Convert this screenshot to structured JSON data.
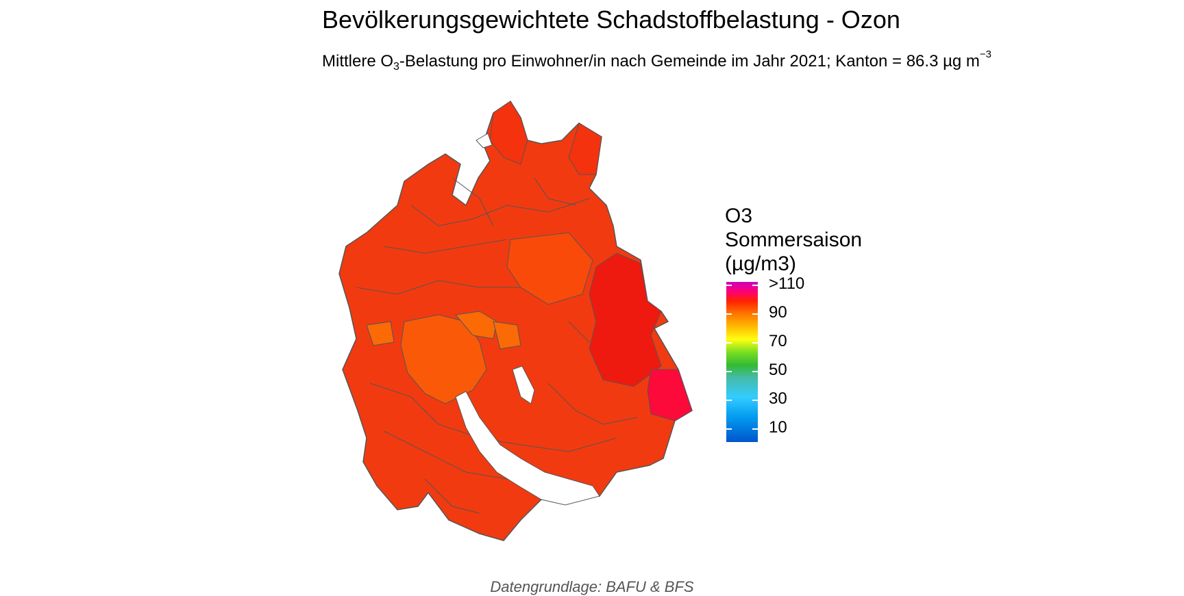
{
  "title": "Bevölkerungsgewichtete Schadstoffbelastung - Ozon",
  "subtitle": {
    "pre": "Mittlere O",
    "sub": "3",
    "mid": "-Belastung pro Einwohner/in nach Gemeinde im Jahr 2021; Kanton = 86.3 µg m",
    "sup": "−3"
  },
  "legend": {
    "title_lines": [
      "O3",
      "Sommersaison",
      "(µg/m3)"
    ],
    "labels": [
      ">110",
      "90",
      "70",
      "50",
      "30",
      "10"
    ]
  },
  "colors": {
    "region_fill": "#f23a10",
    "border": "#555555",
    "center": "#fa5a08",
    "highlight_orange": "#fb6a05",
    "east_red": "#ee1a10",
    "southeast_pink": "#fb0a3a"
  },
  "source": "Datengrundlage: BAFU & BFS"
}
